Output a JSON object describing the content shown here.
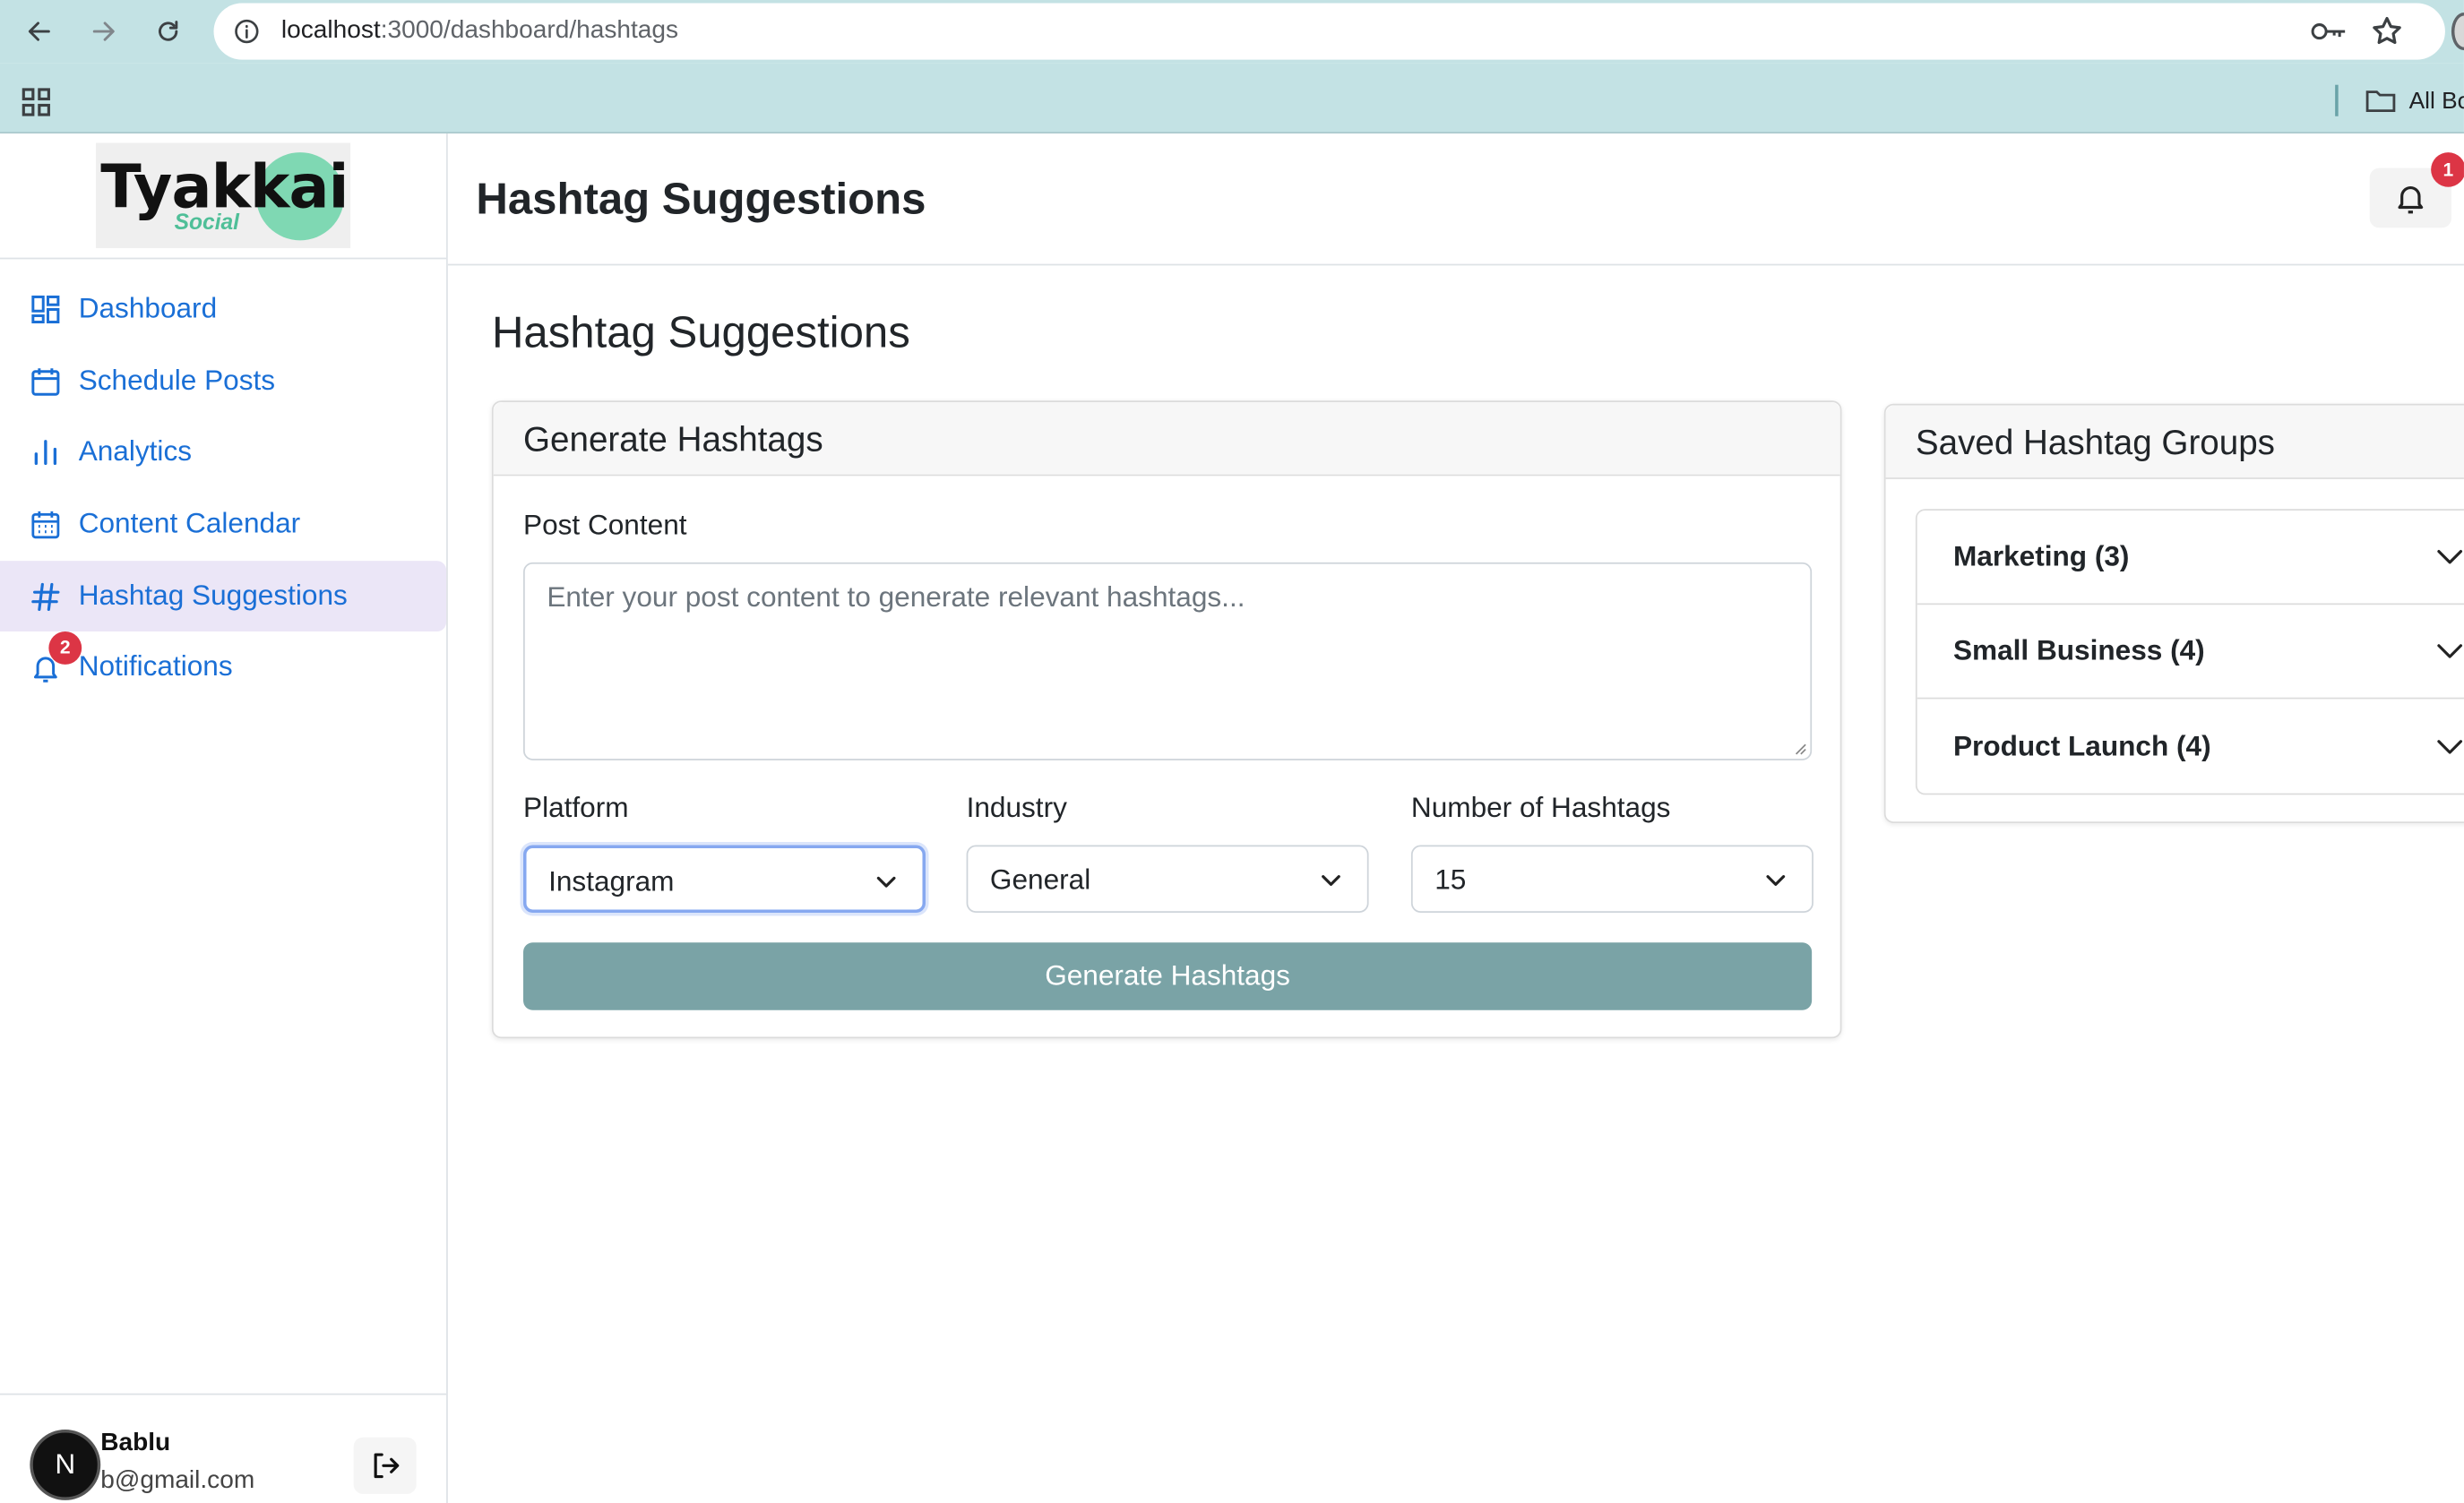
{
  "browser": {
    "url_host": "localhost",
    "url_path": ":3000/dashboard/hashtags",
    "bookmarks_label": "All Bo"
  },
  "sidebar": {
    "logo_text": "Tyakkai",
    "logo_sub": "Social",
    "items": [
      {
        "label": "Dashboard",
        "icon": "dashboard-icon"
      },
      {
        "label": "Schedule Posts",
        "icon": "calendar-icon"
      },
      {
        "label": "Analytics",
        "icon": "bar-chart-icon"
      },
      {
        "label": "Content Calendar",
        "icon": "calendar-grid-icon"
      },
      {
        "label": "Hashtag Suggestions",
        "icon": "hashtag-icon",
        "active": true
      },
      {
        "label": "Notifications",
        "icon": "bell-icon",
        "badge": "2"
      }
    ],
    "user": {
      "avatar_initial": "N",
      "name": "Bablu",
      "email": "b@gmail.com"
    }
  },
  "header": {
    "title": "Hashtag Suggestions",
    "notification_badge": "1"
  },
  "main": {
    "heading": "Hashtag Suggestions",
    "generate_card": {
      "title": "Generate Hashtags",
      "post_content_label": "Post Content",
      "post_content_placeholder": "Enter your post content to generate relevant hashtags...",
      "platform_label": "Platform",
      "platform_value": "Instagram",
      "industry_label": "Industry",
      "industry_value": "General",
      "count_label": "Number of Hashtags",
      "count_value": "15",
      "button_label": "Generate Hashtags"
    },
    "saved_card": {
      "title": "Saved Hashtag Groups",
      "groups": [
        {
          "label": "Marketing (3)"
        },
        {
          "label": "Small Business (4)"
        },
        {
          "label": "Product Launch (4)"
        }
      ]
    }
  },
  "colors": {
    "accent_link": "#1a6fd6",
    "active_bg": "#ebe6f7",
    "button_bg": "#7aa3a6",
    "badge": "#dc3545",
    "chrome": "#c3e2e4"
  }
}
